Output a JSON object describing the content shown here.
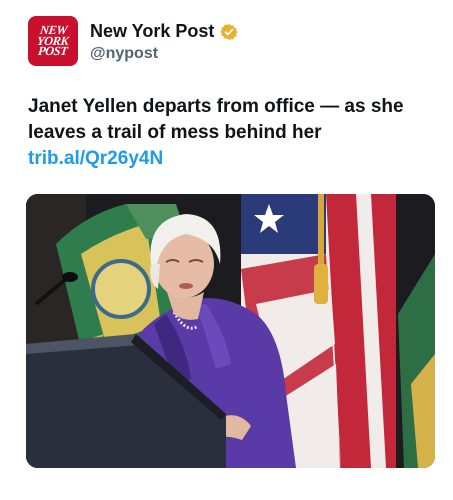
{
  "author": {
    "avatar_text": [
      "NEW",
      "YORK",
      "POST"
    ],
    "display_name": "New York Post",
    "handle": "@nypost",
    "verified_badge_icon": "gold-verified-badge-icon"
  },
  "tweet": {
    "text": "Janet Yellen departs from office — as she leaves a trail of mess behind her ",
    "link_text": "trib.al/Qr26y4N"
  },
  "media": {
    "image_description_icon": "photo-image"
  },
  "colors": {
    "brand_red": "#c8102e",
    "link_blue": "#1d9bf0",
    "verified_gold": "#e8b130",
    "handle_gray": "#536471"
  }
}
